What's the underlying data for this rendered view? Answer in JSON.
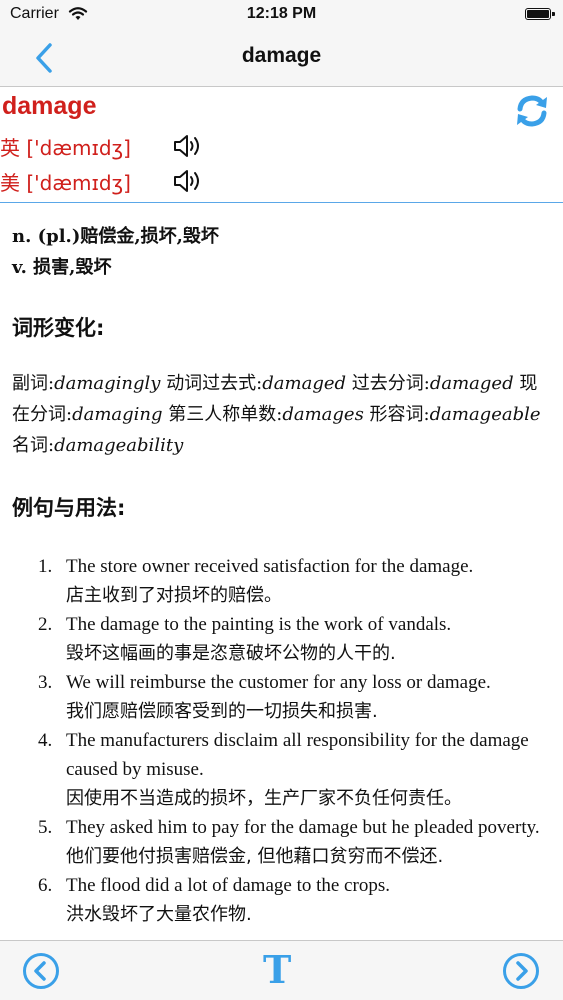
{
  "status_bar": {
    "carrier": "Carrier",
    "time": "12:18 PM"
  },
  "nav": {
    "title": "damage"
  },
  "entry": {
    "headword": "damage",
    "pron_uk": "英 ['dæmɪdʒ]",
    "pron_us": "美 ['dæmɪdʒ]"
  },
  "definitions": [
    "n. (pl.)赔偿金,损坏,毁坏",
    "v. 损害,毁坏"
  ],
  "sections": {
    "forms_title": "词形变化:",
    "examples_title": "例句与用法:"
  },
  "forms": [
    {
      "label": "副词:",
      "value": "damagingly"
    },
    {
      "label": "动词过去式:",
      "value": "damaged"
    },
    {
      "label": "过去分词:",
      "value": "damaged"
    },
    {
      "label": "现在分词:",
      "value": "damaging"
    },
    {
      "label": "第三人称单数:",
      "value": "damages"
    },
    {
      "label": "形容词:",
      "value": "damageable"
    },
    {
      "label": "名词:",
      "value": "damageability"
    }
  ],
  "examples": [
    {
      "num": "1.",
      "en": "The store owner received satisfaction for the damage.",
      "zh": "店主收到了对损坏的赔偿。"
    },
    {
      "num": "2.",
      "en": "The damage to the painting is the work of vandals.",
      "zh": "毁坏这幅画的事是恣意破坏公物的人干的."
    },
    {
      "num": "3.",
      "en": "We will reimburse the customer for any loss or damage.",
      "zh": "我们愿赔偿顾客受到的一切损失和损害."
    },
    {
      "num": "4.",
      "en": "The manufacturers disclaim all responsibility for the damage caused by misuse.",
      "zh": "因使用不当造成的损坏，生产厂家不负任何责任。"
    },
    {
      "num": "5.",
      "en": "They asked him to pay for the damage but he pleaded poverty.",
      "zh": "他们要他付损害赔偿金, 但他藉口贫穷而不偿还."
    },
    {
      "num": "6.",
      "en": "The flood did a lot of damage to the crops.",
      "zh": "洪水毁坏了大量农作物."
    }
  ],
  "toolbar": {
    "font_label": "T"
  },
  "colors": {
    "accent": "#3aa0e8",
    "headword": "#d0201c",
    "divider": "#5aa7e8"
  },
  "icons": [
    "back-chevron-icon",
    "speaker-icon",
    "refresh-icon",
    "previous-circle-icon",
    "next-circle-icon",
    "wifi-icon",
    "battery-icon"
  ]
}
